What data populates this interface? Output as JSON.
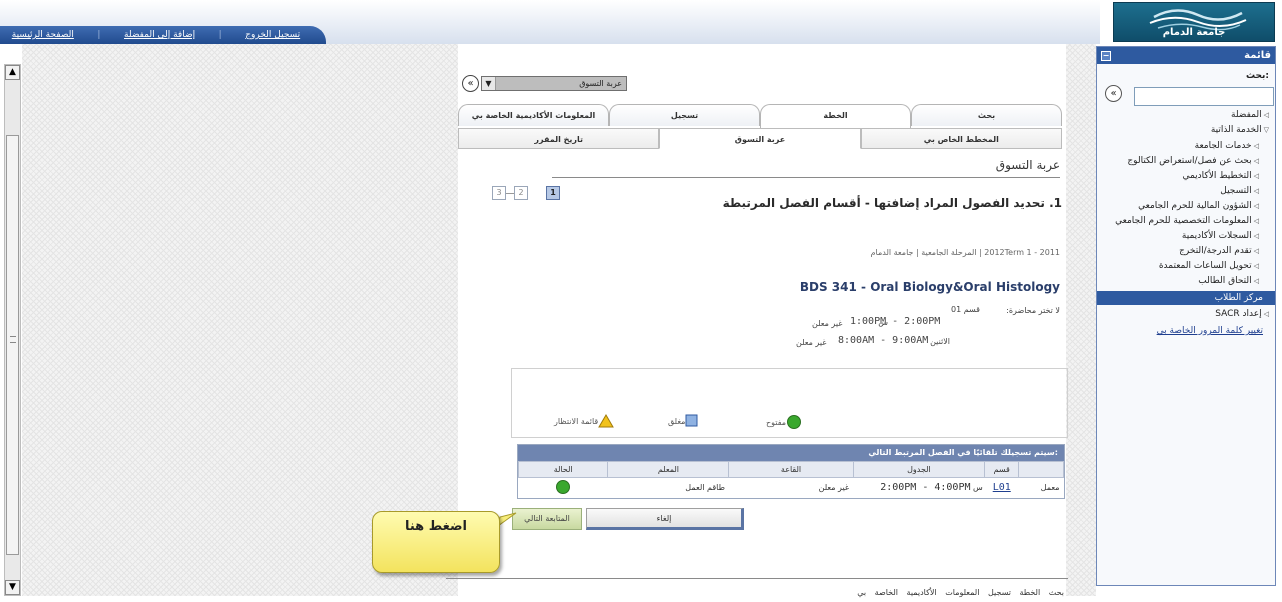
{
  "header": {
    "nav_links": [
      "الصفحة الرئيسية",
      "إضافة إلى المفضلة",
      "تسجيل الخروج"
    ],
    "logo_text": "جامعة الدمام"
  },
  "menu": {
    "title": "قائمة",
    "search_label": "بحث:",
    "items": [
      {
        "label": "المفضلة",
        "level": 0
      },
      {
        "label": "الخدمة الذاتية",
        "level": 0
      },
      {
        "label": "خدمات الجامعة",
        "level": 1
      },
      {
        "label": "بحث عن فصل/استعراض الكتالوج",
        "level": 1
      },
      {
        "label": "التخطيط الأكاديمي",
        "level": 1
      },
      {
        "label": "التسجيل",
        "level": 1
      },
      {
        "label": "الشؤون المالية للحرم الجامعي",
        "level": 1
      },
      {
        "label": "المعلومات التخصصية للحرم الجامعي",
        "level": 1
      },
      {
        "label": "السجلات الأكاديمية",
        "level": 1
      },
      {
        "label": "تقدم الدرجة/التخرج",
        "level": 1
      },
      {
        "label": "تحويل الساعات المعتمدة",
        "level": 1
      },
      {
        "label": "التحاق الطالب",
        "level": 1
      }
    ],
    "selected": "مركز الطلاب",
    "after_selected": "إعداد SACR",
    "link": "تغيير كلمة المرور الخاصة بي"
  },
  "jump": {
    "value": "عربة التسوق"
  },
  "tabs": [
    "بحث",
    "الخطة",
    "تسجيل",
    "المعلومات الأكاديمية الخاصة بي"
  ],
  "active_tab": "الخطة",
  "subtabs": [
    "المخطط الخاص بي",
    "عربة التسوق",
    "تاريخ المقرر"
  ],
  "active_subtab": "عربة التسوق",
  "page_title": "عربة التسوق",
  "step": {
    "title": "1. تحديد الفصول المراد إضافتها - أقسام الفصل المرتبطة",
    "labels": [
      "1",
      "2",
      "3"
    ],
    "current": 1
  },
  "term": "2011 - 2012Term 1  |  المرحلة الجامعية  |  جامعة الدمام",
  "course": {
    "title": "BDS  341 - Oral Biology&Oral Histology",
    "lecture_label": "لا تختر محاضرة:",
    "section": "قسم 01",
    "sched1_time": "1:00PM - 2:00PM",
    "sched1_day": "س",
    "sched2_time": "8:00AM - 9:00AM",
    "sched2_day": "الاثنين",
    "status_text": "غير معلن"
  },
  "legend": {
    "open": "مفتوح",
    "closed": "مغلق",
    "waitlist": "قائمة الانتظار"
  },
  "class_section": {
    "header": "سيتم تسجيلك تلقائيًا في الفصل المرتبط التالي:",
    "columns": [
      "قسم",
      "الجدول",
      "القاعة",
      "المعلم",
      "الحالة"
    ],
    "row": {
      "type": "معمل",
      "section": "L01",
      "day": "س",
      "time": "2:00PM - 4:00PM",
      "room": "غير معلن",
      "instructor": "طاقم العمل"
    }
  },
  "buttons": {
    "next": "المتابعة التالي",
    "cancel": "إلغاء"
  },
  "callout": "اضغط هنا",
  "bottom_links": [
    "بحث",
    "الخطة",
    "تسجيل",
    "المعلومات الأكاديمية الخاصة بي"
  ],
  "colors": {
    "nav_blue": "#2e5aa0",
    "open_green": "#3aa82e",
    "closed_blue": "#8fb2e2",
    "waitlist_yellow": "#f2c21b",
    "callout_yellow": "#f7ed7a"
  }
}
